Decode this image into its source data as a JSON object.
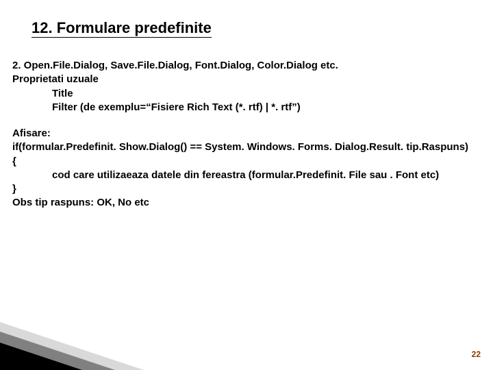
{
  "title": "12. Formulare predefinite",
  "section": {
    "line1": "2. Open.File.Dialog, Save.File.Dialog, Font.Dialog, Color.Dialog etc.",
    "line2": "Proprietati uzuale",
    "prop1": "Title",
    "prop2": "Filter (de exemplu=“Fisiere Rich Text (*. rtf) | *. rtf”)"
  },
  "afisare": {
    "label": "Afisare:",
    "if_line": "if(formular.Predefinit. Show.Dialog() == System. Windows. Forms. Dialog.Result. tip.Raspuns)",
    "open_brace": "{",
    "body_line": "cod care utilizaeaza datele din fereastra (formular.Predefinit. File sau . Font etc)",
    "close_brace": "}",
    "obs": "Obs tip raspuns: OK, No etc"
  },
  "page_number": "22"
}
